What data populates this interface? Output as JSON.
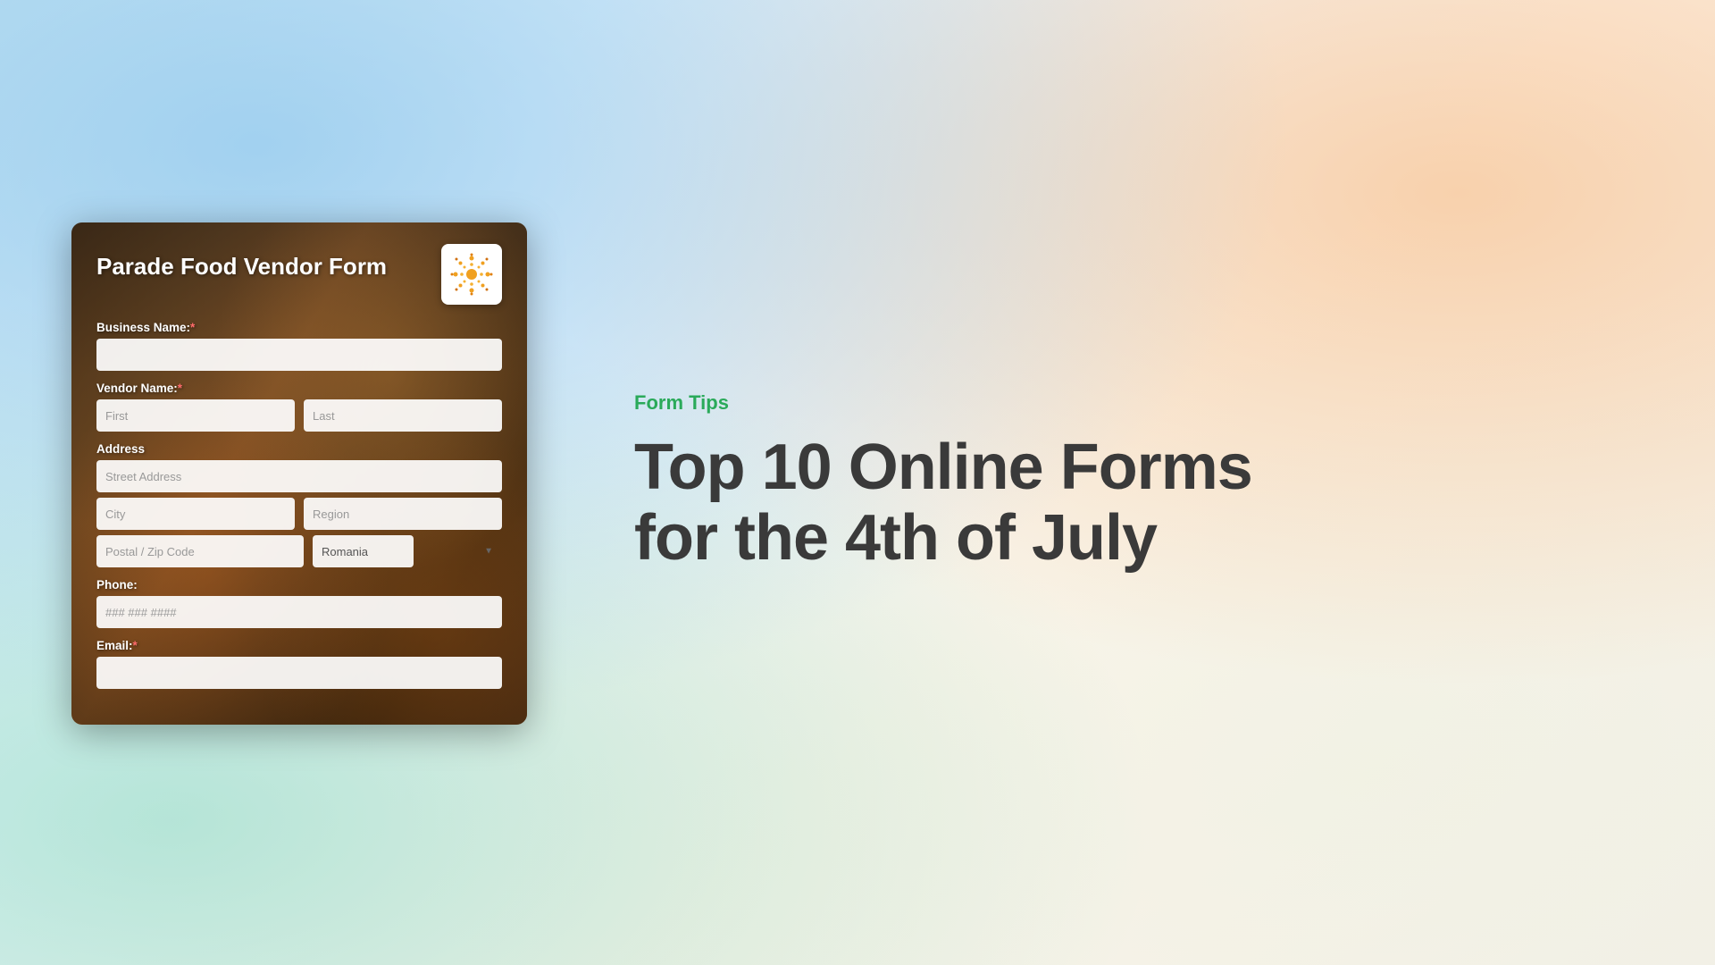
{
  "background": {
    "color": "#e8f4f0"
  },
  "form": {
    "title": "Parade Food Vendor Form",
    "logo_alt": "fireworks-logo",
    "fields": {
      "business_name": {
        "label": "Business Name:",
        "required": true,
        "placeholder": ""
      },
      "vendor_name": {
        "label": "Vendor Name:",
        "required": true,
        "first_placeholder": "First",
        "last_placeholder": "Last"
      },
      "address": {
        "label": "Address",
        "street_placeholder": "Street Address",
        "city_placeholder": "City",
        "region_placeholder": "Region",
        "postal_placeholder": "Postal / Zip Code",
        "country_value": "Romania"
      },
      "phone": {
        "label": "Phone:",
        "placeholder": "### ### ####"
      },
      "email": {
        "label": "Email:",
        "required": true,
        "placeholder": ""
      }
    }
  },
  "article": {
    "category_label": "Form Tips",
    "title_line1": "Top 10 Online Forms",
    "title_line2": "for the 4th of July"
  },
  "colors": {
    "form_tips_green": "#2aaa5a",
    "article_title": "#3a3a3a",
    "required_red": "#ff6b6b"
  }
}
